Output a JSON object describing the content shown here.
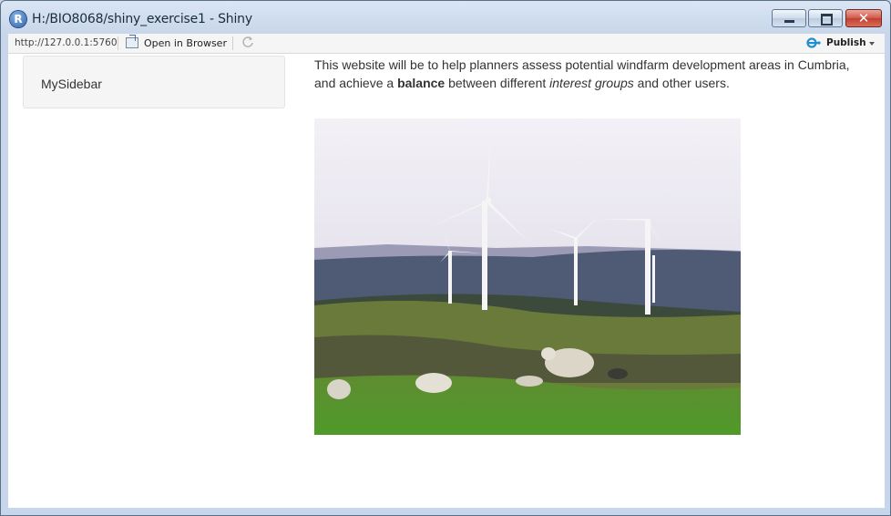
{
  "window": {
    "title": "H:/BIO8068/shiny_exercise1 - Shiny",
    "app_icon_letter": "R",
    "close_glyph": "✕"
  },
  "toolbar": {
    "url": "http://127.0.0.1:5760",
    "open_in_browser_label": "Open in Browser",
    "publish_label": "Publish"
  },
  "sidebar": {
    "label": "MySidebar"
  },
  "main": {
    "text_1": "This website will be to help planners assess potential windfarm development areas in Cumbria, and achieve a ",
    "bold": "balance",
    "text_2": " between different ",
    "italic": "interest groups",
    "text_3": " and other users."
  },
  "image": {
    "description": "wind-turbines-with-sheep-photo"
  },
  "colors": {
    "accent": "#2a5fa8",
    "publish_icon": "#1f8fd1"
  }
}
